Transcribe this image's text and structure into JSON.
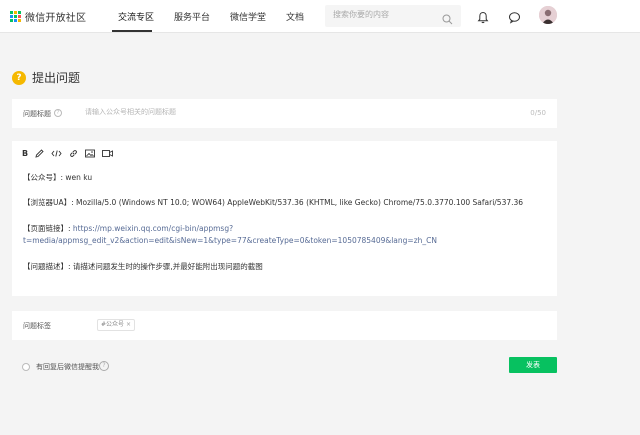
{
  "header": {
    "logo_text": "微信开放社区",
    "nav": [
      "交流专区",
      "服务平台",
      "微信学堂",
      "文档"
    ],
    "search_placeholder": "搜索你要的内容"
  },
  "page": {
    "title": "提出问题",
    "title_badge": "?"
  },
  "title_field": {
    "label": "问题标题",
    "help": "?",
    "placeholder": "请输入公众号相关的问题标题",
    "counter": "0/50"
  },
  "editor": {
    "toolbar": [
      "B",
      "pen-icon",
      "code-icon",
      "link-icon",
      "image-icon",
      "video-icon"
    ],
    "lines": {
      "account_key": "【公众号】",
      "account_val": ": wen ku",
      "browser_key": "【浏览器UA】",
      "browser_val": ": Mozilla/5.0 (Windows NT 10.0; WOW64) AppleWebKit/537.36 (KHTML, like Gecko) Chrome/75.0.3770.100 Safari/537.36",
      "link_key": "【页面链接】",
      "link_sep": ": ",
      "link_url_1": "https://mp.weixin.qq.com/cgi-bin/appmsg?",
      "link_url_2": "t=media/appmsg_edit_v2&action=edit&isNew=1&type=77&createType=0&token=1050785409&lang=zh_CN",
      "desc_key": "【问题描述】",
      "desc_val": ": 请描述问题发生时的操作步骤,并最好能附出现问题的截图"
    }
  },
  "tags_field": {
    "label": "问题标签",
    "tag": "#公众号",
    "tag_close": "×"
  },
  "footer": {
    "notify_label": "有回复后微信提醒我",
    "help": "?",
    "submit": "发表"
  },
  "colors": {
    "accent_green": "#07c160",
    "badge_yellow": "#f5b800",
    "link_blue": "#576b95"
  }
}
